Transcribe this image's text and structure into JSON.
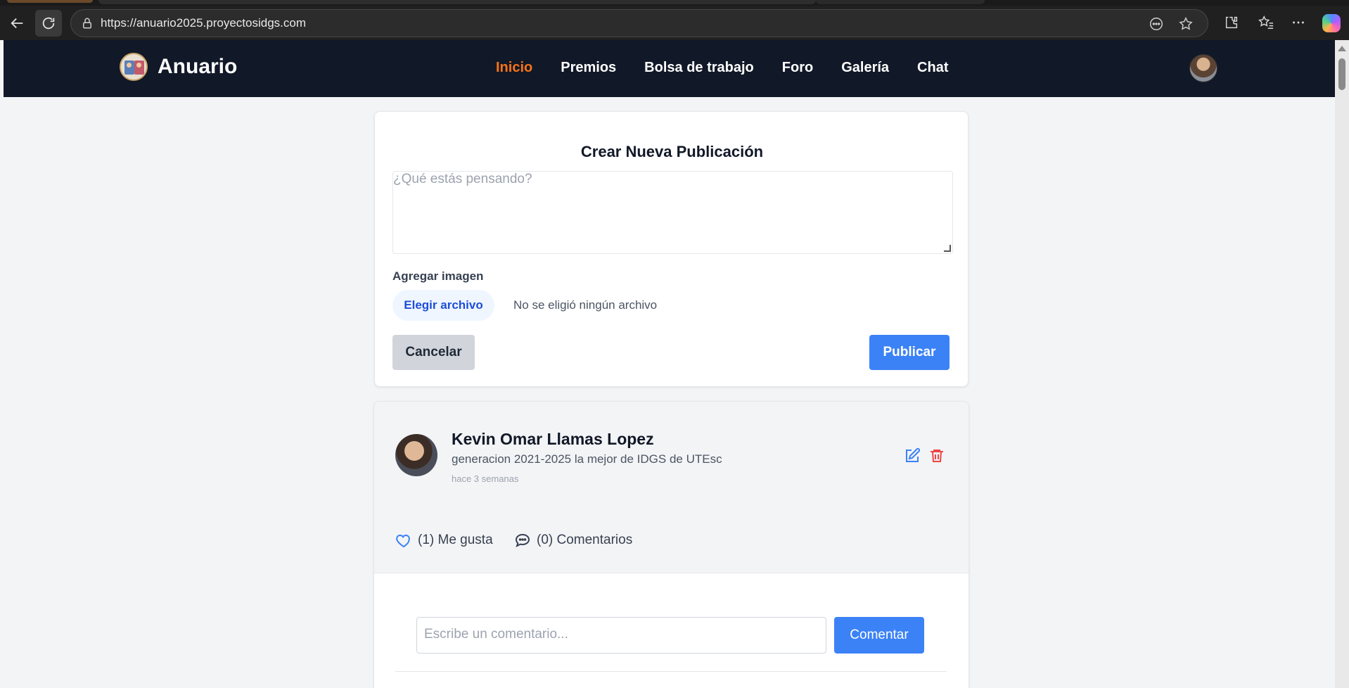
{
  "browser": {
    "url": "https://anuario2025.proyectosidgs.com",
    "icons": {
      "back": "arrow-left-icon",
      "reload": "reload-icon",
      "lock": "lock-icon",
      "reader": "dots-circle-icon",
      "favorite": "star-icon",
      "extensions": "puzzle-icon",
      "favorites": "star-list-icon",
      "menu": "ellipsis-icon",
      "copilot": "copilot-icon"
    }
  },
  "navbar": {
    "brand": "Anuario",
    "links": [
      "Inicio",
      "Premios",
      "Bolsa de trabajo",
      "Foro",
      "Galería",
      "Chat"
    ],
    "active_link": "Inicio",
    "accent_color": "#f97316",
    "background": "#111827"
  },
  "create_post": {
    "title": "Crear Nueva Publicación",
    "textarea_placeholder": "¿Qué estás pensando?",
    "image_label": "Agregar imagen",
    "file_button": "Elegir archivo",
    "file_status": "No se eligió ningún archivo",
    "cancel_label": "Cancelar",
    "publish_label": "Publicar"
  },
  "post": {
    "author": "Kevin Omar Llamas Lopez",
    "content": "generacion 2021-2025 la mejor de IDGS de UTEsc",
    "time": "hace 3 semanas",
    "likes_label": "(1) Me gusta",
    "comments_label": "(0) Comentarios",
    "comment_placeholder": "Escribe un comentario...",
    "comment_button": "Comentar"
  },
  "colors": {
    "primary": "#3b82f6",
    "danger": "#ef4444"
  }
}
